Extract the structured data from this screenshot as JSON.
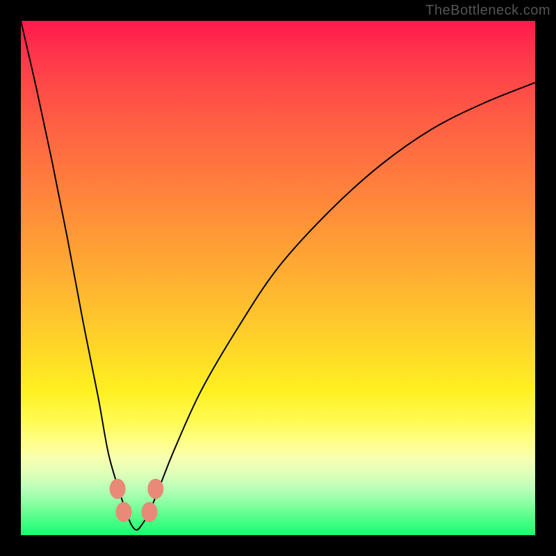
{
  "watermark": "TheBottleneck.com",
  "chart_data": {
    "type": "line",
    "title": "",
    "xlabel": "",
    "ylabel": "",
    "x": [
      0.0,
      0.03,
      0.06,
      0.09,
      0.12,
      0.15,
      0.17,
      0.19,
      0.205,
      0.215,
      0.225,
      0.235,
      0.25,
      0.27,
      0.3,
      0.35,
      0.42,
      0.5,
      0.6,
      0.7,
      0.8,
      0.9,
      1.0
    ],
    "values": [
      1.0,
      0.87,
      0.73,
      0.58,
      0.42,
      0.27,
      0.16,
      0.09,
      0.045,
      0.02,
      0.01,
      0.02,
      0.045,
      0.095,
      0.17,
      0.28,
      0.4,
      0.52,
      0.63,
      0.72,
      0.79,
      0.84,
      0.88
    ],
    "ylim": [
      0,
      1
    ],
    "xlim": [
      0,
      1
    ],
    "markers": {
      "x": [
        0.188,
        0.2,
        0.25,
        0.262
      ],
      "y": [
        0.09,
        0.045,
        0.045,
        0.09
      ]
    },
    "background_gradient": {
      "top": "#ff1a4d",
      "mid": "#ffd828",
      "bottom": "#18ff6f"
    }
  }
}
